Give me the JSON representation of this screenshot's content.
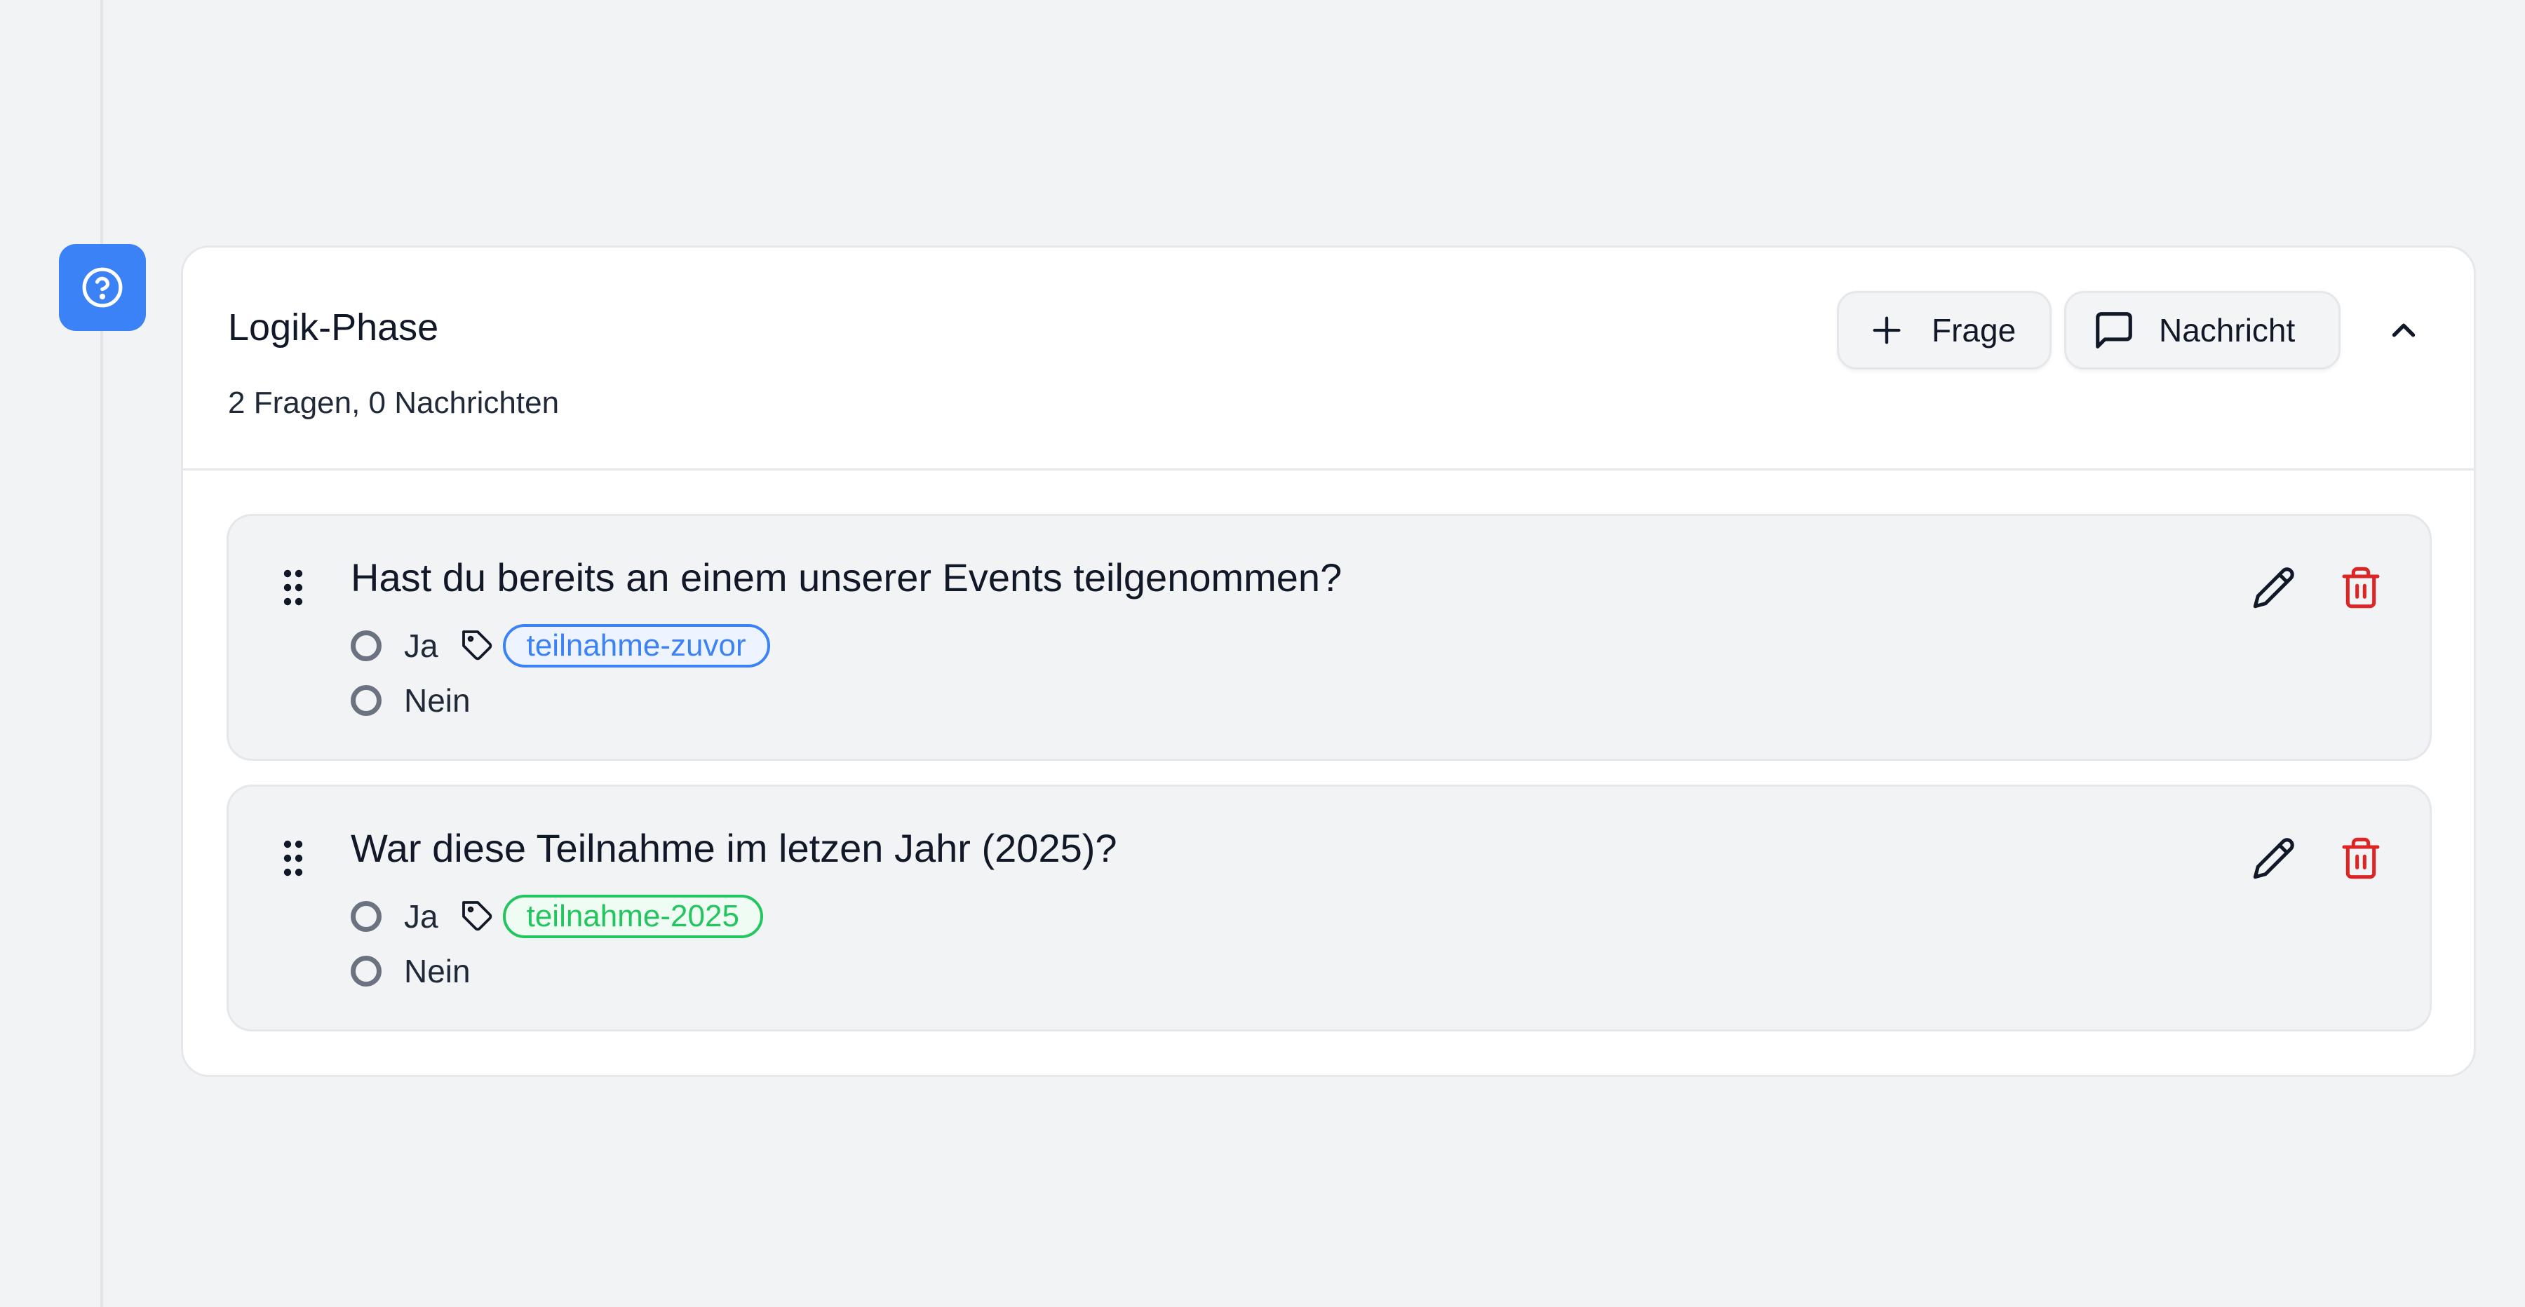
{
  "phase": {
    "title": "Logik-Phase",
    "subtitle": "2 Fragen, 0 Nachrichten",
    "badge_icon": "help-circle-icon",
    "badge_color": "#3b82f6",
    "actions": {
      "add_question_label": "Frage",
      "add_question_icon": "plus-icon",
      "add_message_label": "Nachricht",
      "add_message_icon": "message-square-icon",
      "collapse_icon": "chevron-up-icon"
    }
  },
  "questions": [
    {
      "text": "Hast du bereits an einem unserer Events teilgenommen?",
      "answers": [
        {
          "label": "Ja",
          "tag": "teilnahme-zuvor",
          "tag_color": "#3b82f6"
        },
        {
          "label": "Nein"
        }
      ]
    },
    {
      "text": "War diese Teilnahme im letzen Jahr (2025)?",
      "answers": [
        {
          "label": "Ja",
          "tag": "teilnahme-2025",
          "tag_color": "#22c55e"
        },
        {
          "label": "Nein"
        }
      ]
    }
  ],
  "colors": {
    "delete": "#dc2626",
    "accent": "#3b82f6"
  }
}
